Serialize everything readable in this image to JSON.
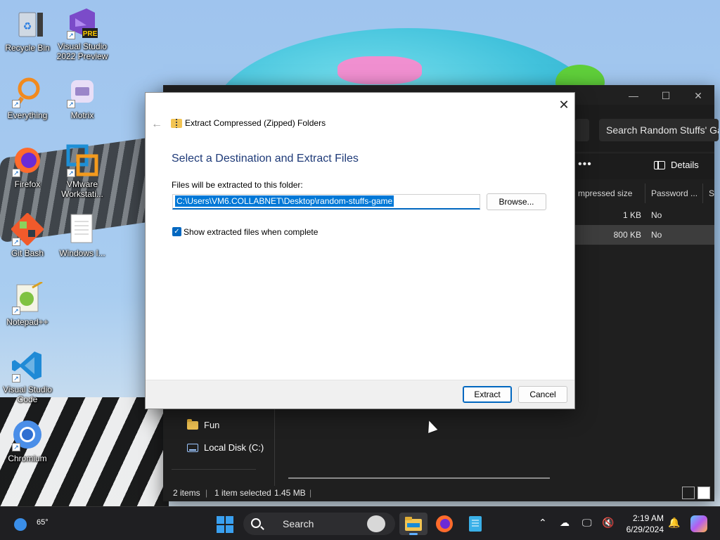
{
  "desktop": {
    "icons": [
      {
        "label": "Recycle Bin",
        "icon": "recycle-bin-icon"
      },
      {
        "label": "Visual Studio 2022 Preview",
        "icon": "visual-studio-icon",
        "badge": "PRE"
      },
      {
        "label": "Everything",
        "icon": "everything-search-icon"
      },
      {
        "label": "Motrix",
        "icon": "motrix-icon"
      },
      {
        "label": "Firefox",
        "icon": "firefox-icon"
      },
      {
        "label": "VMware Workstati...",
        "icon": "vmware-icon"
      },
      {
        "label": "Git Bash",
        "icon": "git-bash-icon"
      },
      {
        "label": "Windows I...",
        "icon": "document-icon"
      },
      {
        "label": "Notepad++",
        "icon": "notepadpp-icon"
      },
      {
        "label": "Visual Studio Code",
        "icon": "vscode-icon"
      },
      {
        "label": "Chromium",
        "icon": "chromium-icon"
      }
    ]
  },
  "explorer": {
    "search_placeholder": "Search Random Stuffs' Ga",
    "toolbar_more": "•••",
    "details_label": "Details",
    "columns": [
      "mpressed size",
      "Password ...",
      "Si"
    ],
    "rows": [
      {
        "size": "1 KB",
        "password": "No",
        "selected": false
      },
      {
        "size": "800 KB",
        "password": "No",
        "selected": true
      }
    ],
    "nav": [
      {
        "label": "Fun",
        "icon": "folder-icon"
      },
      {
        "label": "Local Disk (C:)",
        "icon": "drive-icon"
      }
    ],
    "status": {
      "items": "2 items",
      "selected": "1 item selected",
      "size": "1.45 MB"
    }
  },
  "dialog": {
    "title": "Extract Compressed (Zipped) Folders",
    "heading": "Select a Destination and Extract Files",
    "path_label": "Files will be extracted to this folder:",
    "path_value": "C:\\Users\\VM6.COLLABNET\\Desktop\\random-stuffs-game",
    "browse_label": "Browse...",
    "checkbox_label": "Show extracted files when complete",
    "checkbox_checked": true,
    "extract_label": "Extract",
    "cancel_label": "Cancel",
    "close_glyph": "✕",
    "back_glyph": "←"
  },
  "taskbar": {
    "temperature": "65°",
    "search_label": "Search",
    "time": "2:19 AM",
    "date": "6/29/2024",
    "apps": [
      "file-explorer-icon",
      "firefox-icon",
      "notepad-icon"
    ],
    "accent": "#60b0ff"
  },
  "colors": {
    "dialog_heading": "#1e3a78",
    "accent": "#0067c0",
    "explorer_bg": "#1f1f1f"
  }
}
